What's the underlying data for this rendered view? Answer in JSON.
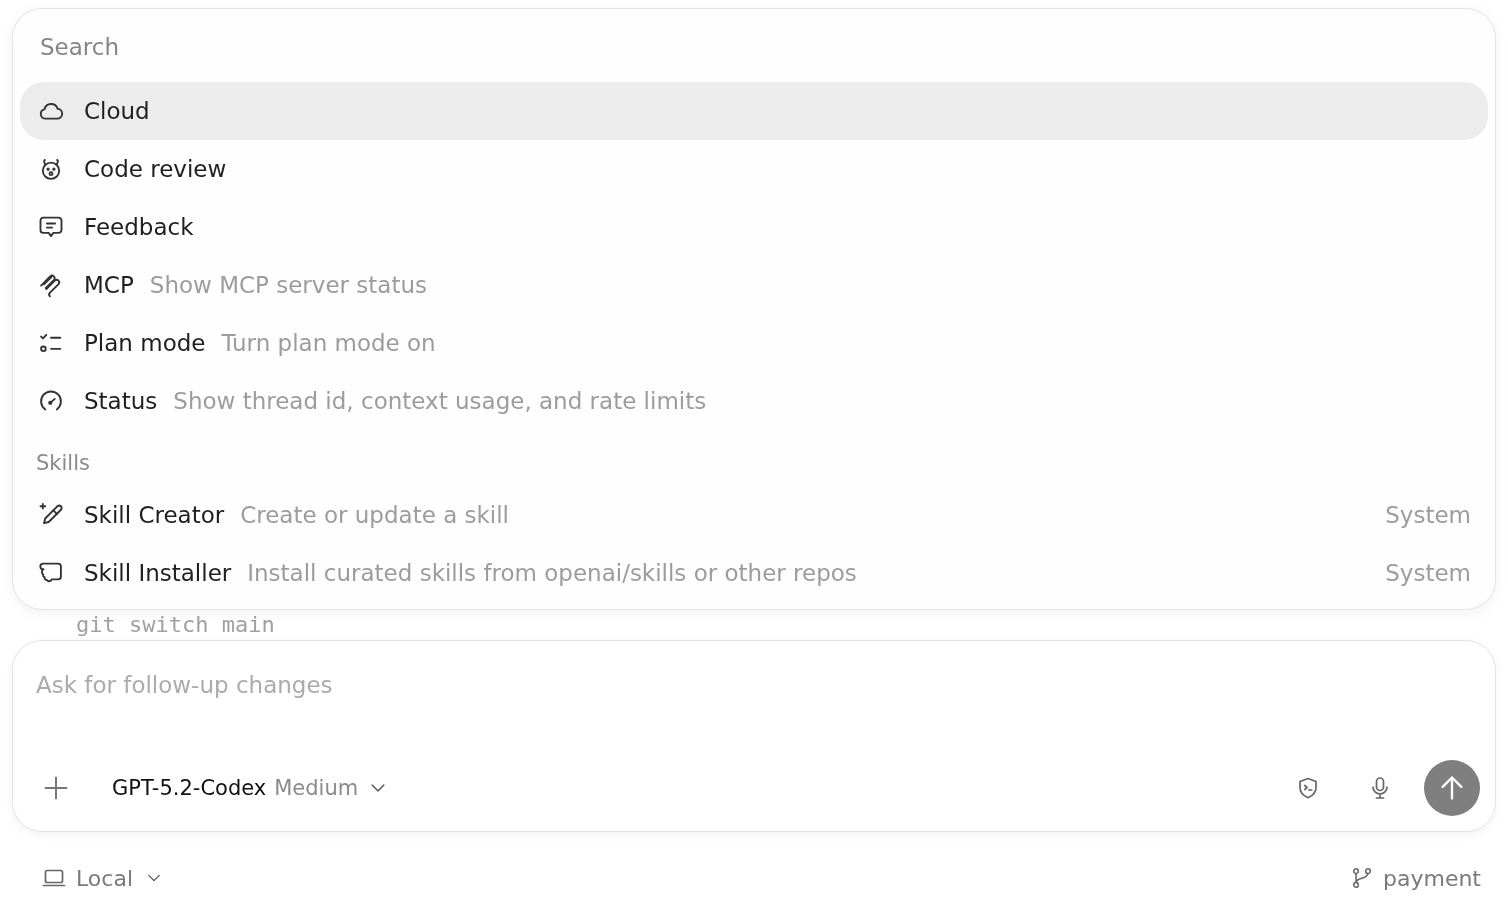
{
  "search": {
    "placeholder": "Search"
  },
  "commands": [
    {
      "label": "Cloud",
      "selected": true
    },
    {
      "label": "Code review",
      "selected": false
    },
    {
      "label": "Feedback",
      "selected": false
    },
    {
      "label": "MCP",
      "description": "Show MCP server status",
      "selected": false
    },
    {
      "label": "Plan mode",
      "description": "Turn plan mode on",
      "selected": false
    },
    {
      "label": "Status",
      "description": "Show thread id, context usage, and rate limits",
      "selected": false
    }
  ],
  "skills": {
    "heading": "Skills",
    "items": [
      {
        "label": "Skill Creator",
        "description": "Create or update a skill",
        "source": "System",
        "selected": false
      },
      {
        "label": "Skill Installer",
        "description": "Install curated skills from openai/skills or other repos",
        "source": "System",
        "selected": false
      }
    ]
  },
  "background": {
    "code_line": "git switch main"
  },
  "composer": {
    "placeholder": "Ask for follow-up changes",
    "model": "GPT-5.2-Codex",
    "effort": "Medium",
    "send_disabled": true
  },
  "footer": {
    "environment": "Local",
    "branch": "payment"
  }
}
